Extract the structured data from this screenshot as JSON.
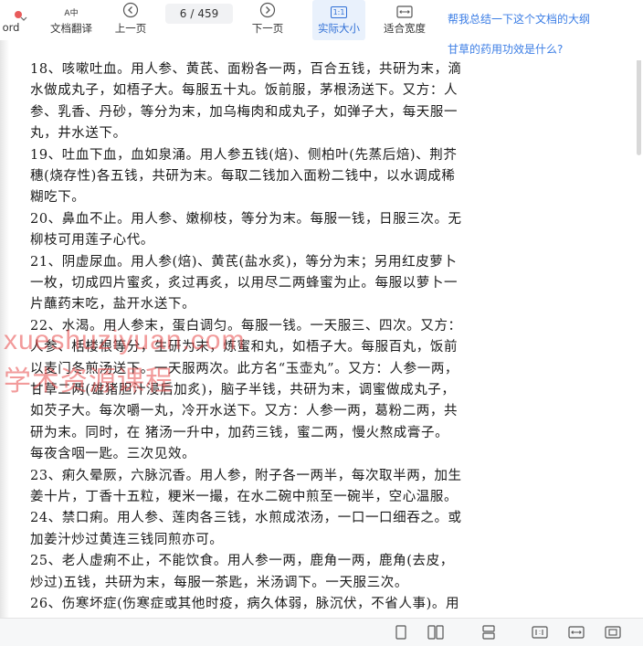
{
  "toolbar": {
    "word_label": "ord",
    "translate_label": "文档翻译",
    "prev_label": "上一页",
    "page_current": "6",
    "page_separator": "/",
    "page_total": "459",
    "next_label": "下一页",
    "actual_size_label": "实际大小",
    "actual_size_icon_text": "1:1",
    "fit_width_label": "适合宽度",
    "translate_icon_text": "A中"
  },
  "ai_panel": {
    "suggestion_1": "帮我总结一下这个文档的大纲",
    "suggestion_2": "甘草的药用功效是什么?"
  },
  "document": {
    "lines": [
      "18、咳嗽吐血。用人参、黄芪、面粉各一两，百合五钱，共研为末，滴",
      "水做成丸子，如梧子大。每服五十丸。饭前服，茅根汤送下。又方：人",
      "参、乳香、丹砂，等分为末，加乌梅肉和成丸子，如弹子大，每天服一",
      "丸，井水送下。",
      "19、吐血下血，血如泉涌。用人参五钱(焙)、侧柏叶(先蒸后焙)、荆芥",
      "穗(烧存性)各五钱，共研为末。每取二钱加入面粉二钱中，以水调成稀",
      "糊吃下。",
      "20、鼻血不止。用人参、嫩柳枝，等分为末。每服一钱，日服三次。无",
      "柳枝可用莲子心代。",
      "21、阴虚尿血。用人参(焙)、黄芪(盐水炙)，等分为末；另用红皮萝卜",
      "一枚，切成四片蜜炙，炙过再炙，以用尽二两蜂蜜为止。每服以萝卜一",
      "片蘸药末吃，盐开水送下。",
      "22、水渴。用人参末，蛋白调匀。每服一钱。一天服三、四次。又方：",
      "人参、栝楼根等分，生研为末，炼蜜和丸，如梧子大。每服百丸，饭前",
      "以麦门冬煎汤送下。一天服两次。此方名“玉壶丸”。又方：人参一两，",
      "甘草二两(雄猪胆汁浸后加炙)，脑子半钱，共研为末，调蜜做成丸子，",
      "如芡子大。每次嚼一丸，冷开水送下。又方：人参一两，葛粉二两，共",
      "研为末。同时，在 猪汤一升中，加药三钱，蜜二两，慢火熬成膏子。",
      "每夜含咽一匙。三次见效。",
      "23、痢久晕厥，六脉沉香。用人参，附子各一两半，每次取半两，加生",
      "姜十片，丁香十五粒，粳米一撮，在水二碗中煎至一碗半，空心温服。",
      "24、禁口痢。用人参、莲肉各三钱，水煎成浓汤，一口一口细吞之。或",
      "加姜汁炒过黄连三钱同煎亦可。",
      "25、老人虚痢不止，不能饮食。用人参一两，鹿角一两，鹿角(去皮，",
      "炒过)五钱，共研为末，每服一茶匙，米汤调下。一天服三次。",
      "26、伤寒坏症(伤寒症或其他时疫，病久体弱，脉沉伏，不省人事)。用"
    ]
  },
  "watermark": {
    "line_1": "xueshuziyuan.com",
    "line_2": "学术资源课程"
  },
  "colors": {
    "accent": "#2f6fd6",
    "link": "#3c7ee5",
    "watermark": "#e84848"
  }
}
